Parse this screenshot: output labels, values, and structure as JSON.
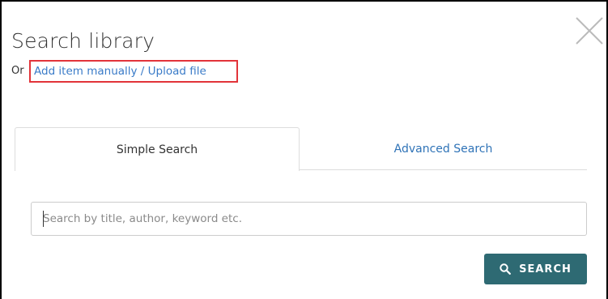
{
  "dialog": {
    "title": "Search library",
    "or_text": "Or",
    "add_item_link": "Add item manually / Upload file",
    "close_icon": "close-icon"
  },
  "tabs": [
    {
      "label": "Simple Search",
      "active": true
    },
    {
      "label": "Advanced Search",
      "active": false
    }
  ],
  "search": {
    "placeholder": "Search by title, author, keyword etc.",
    "value": "",
    "button_label": "SEARCH",
    "button_icon": "search-icon"
  },
  "colors": {
    "link": "#3a7bc8",
    "highlight_border": "#e2343a",
    "button_bg": "#2e6a73"
  }
}
